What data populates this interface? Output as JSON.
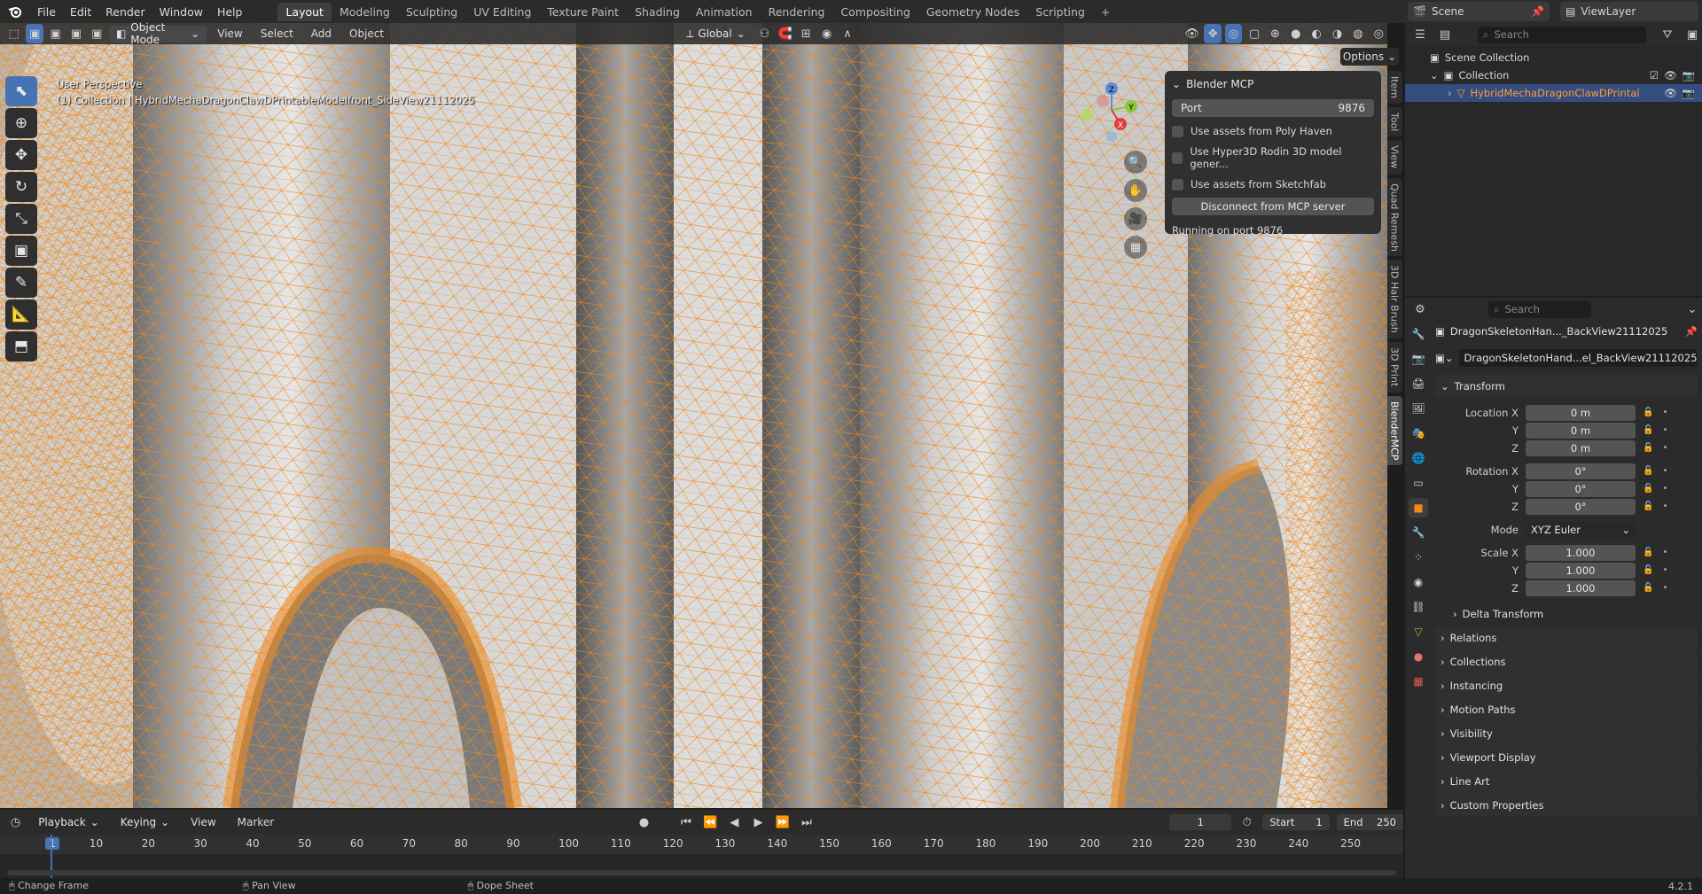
{
  "topbar": {
    "menus": [
      "File",
      "Edit",
      "Render",
      "Window",
      "Help"
    ],
    "workspaces": [
      "Layout",
      "Modeling",
      "Sculpting",
      "UV Editing",
      "Texture Paint",
      "Shading",
      "Animation",
      "Rendering",
      "Compositing",
      "Geometry Nodes",
      "Scripting"
    ],
    "active_workspace": "Layout",
    "add_tab": "+",
    "scene": "Scene",
    "view_layer": "ViewLayer"
  },
  "viewport": {
    "mode": "Object Mode",
    "menus": [
      "View",
      "Select",
      "Add",
      "Object"
    ],
    "orientation": "Global",
    "options": "Options",
    "overlay_line1": "User Perspective",
    "overlay_line2": "(1) Collection | HybridMechaDragonClawDPrintableModelfront_SideView21112025",
    "gizmo_axes": [
      "Z",
      "Y",
      "X"
    ]
  },
  "mcp_panel": {
    "title": "Blender MCP",
    "port_label": "Port",
    "port_value": "9876",
    "check_polyhaven": "Use assets from Poly Haven",
    "check_hyper3d": "Use Hyper3D Rodin 3D model gener...",
    "check_sketchfab": "Use assets from Sketchfab",
    "disconnect": "Disconnect from MCP server",
    "status": "Running on port 9876"
  },
  "side_tabs": [
    "Item",
    "Tool",
    "View",
    "Quad Remesh",
    "3D Hair Brush",
    "3D Print",
    "BlenderMCP"
  ],
  "timeline": {
    "menus": [
      "Playback",
      "Keying",
      "View",
      "Marker"
    ],
    "current_frame": "1",
    "start_label": "Start",
    "start": "1",
    "end_label": "End",
    "end": "250",
    "ticks": [
      "1",
      "10",
      "20",
      "30",
      "40",
      "50",
      "60",
      "70",
      "80",
      "90",
      "100",
      "110",
      "120",
      "130",
      "140",
      "150",
      "160",
      "170",
      "180",
      "190",
      "200",
      "210",
      "220",
      "230",
      "240",
      "250"
    ]
  },
  "status": {
    "change_frame": "Change Frame",
    "pan_view": "Pan View",
    "dope_sheet": "Dope Sheet",
    "version": "4.2.1"
  },
  "outliner": {
    "search": "Search",
    "scene_collection": "Scene Collection",
    "collection": "Collection",
    "object": "HybridMechaDragonClawDPrintal"
  },
  "properties": {
    "search": "Search",
    "object_name": "DragonSkeletonHan..._BackView21112025",
    "data_name": "DragonSkeletonHand...el_BackView21112025",
    "transform": "Transform",
    "location_x_label": "Location X",
    "location_x": "0 m",
    "location_y_label": "Y",
    "location_y": "0 m",
    "location_z_label": "Z",
    "location_z": "0 m",
    "rotation_x_label": "Rotation X",
    "rotation_x": "0°",
    "rotation_y_label": "Y",
    "rotation_y": "0°",
    "rotation_z_label": "Z",
    "rotation_z": "0°",
    "mode_label": "Mode",
    "mode": "XYZ Euler",
    "scale_x_label": "Scale X",
    "scale_x": "1.000",
    "scale_y_label": "Y",
    "scale_y": "1.000",
    "scale_z_label": "Z",
    "scale_z": "1.000",
    "delta": "Delta Transform",
    "sections": [
      "Relations",
      "Collections",
      "Instancing",
      "Motion Paths",
      "Visibility",
      "Viewport Display",
      "Line Art",
      "Custom Properties"
    ]
  },
  "colors": {
    "accent": "#4772b3",
    "wire": "#f08a1c",
    "selected_text": "#ff9d2e"
  }
}
